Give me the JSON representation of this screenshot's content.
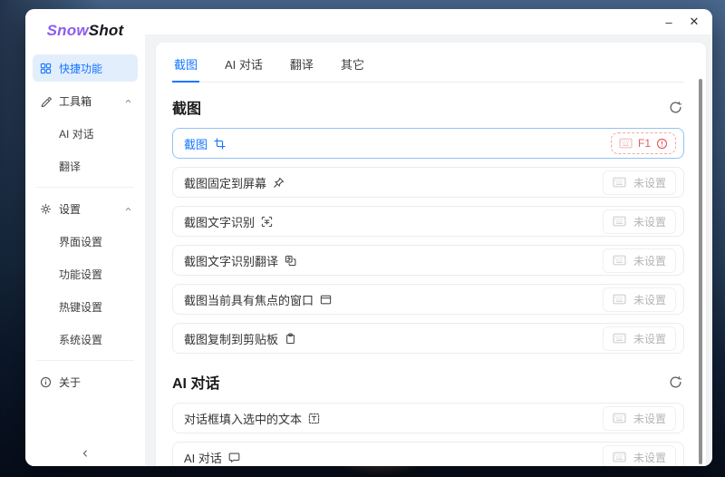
{
  "brand": {
    "name_accent": "Snow",
    "name_rest": "Shot"
  },
  "window_controls": {
    "minimize": "–",
    "close": "✕"
  },
  "sidebar": {
    "nav": [
      {
        "label": "快捷功能"
      },
      {
        "label": "工具箱"
      },
      {
        "label": "AI 对话"
      },
      {
        "label": "翻译"
      },
      {
        "label": "设置"
      },
      {
        "label": "界面设置"
      },
      {
        "label": "功能设置"
      },
      {
        "label": "热键设置"
      },
      {
        "label": "系统设置"
      },
      {
        "label": "关于"
      }
    ]
  },
  "tabs": [
    {
      "label": "截图"
    },
    {
      "label": "AI 对话"
    },
    {
      "label": "翻译"
    },
    {
      "label": "其它"
    }
  ],
  "content": {
    "sections": [
      {
        "title": "截图",
        "rows": [
          {
            "label": "截图",
            "key": "F1"
          },
          {
            "label": "截图固定到屏幕",
            "status": "未设置"
          },
          {
            "label": "截图文字识别",
            "status": "未设置"
          },
          {
            "label": "截图文字识别翻译",
            "status": "未设置"
          },
          {
            "label": "截图当前具有焦点的窗口",
            "status": "未设置"
          },
          {
            "label": "截图复制到剪贴板",
            "status": "未设置"
          }
        ]
      },
      {
        "title": "AI 对话",
        "rows": [
          {
            "label": "对话框填入选中的文本",
            "status": "未设置"
          },
          {
            "label": "AI 对话",
            "status": "未设置"
          }
        ]
      }
    ]
  },
  "colors": {
    "accent": "#1677ff",
    "danger": "#e25d5d",
    "selected_bg": "#e3eefc"
  }
}
